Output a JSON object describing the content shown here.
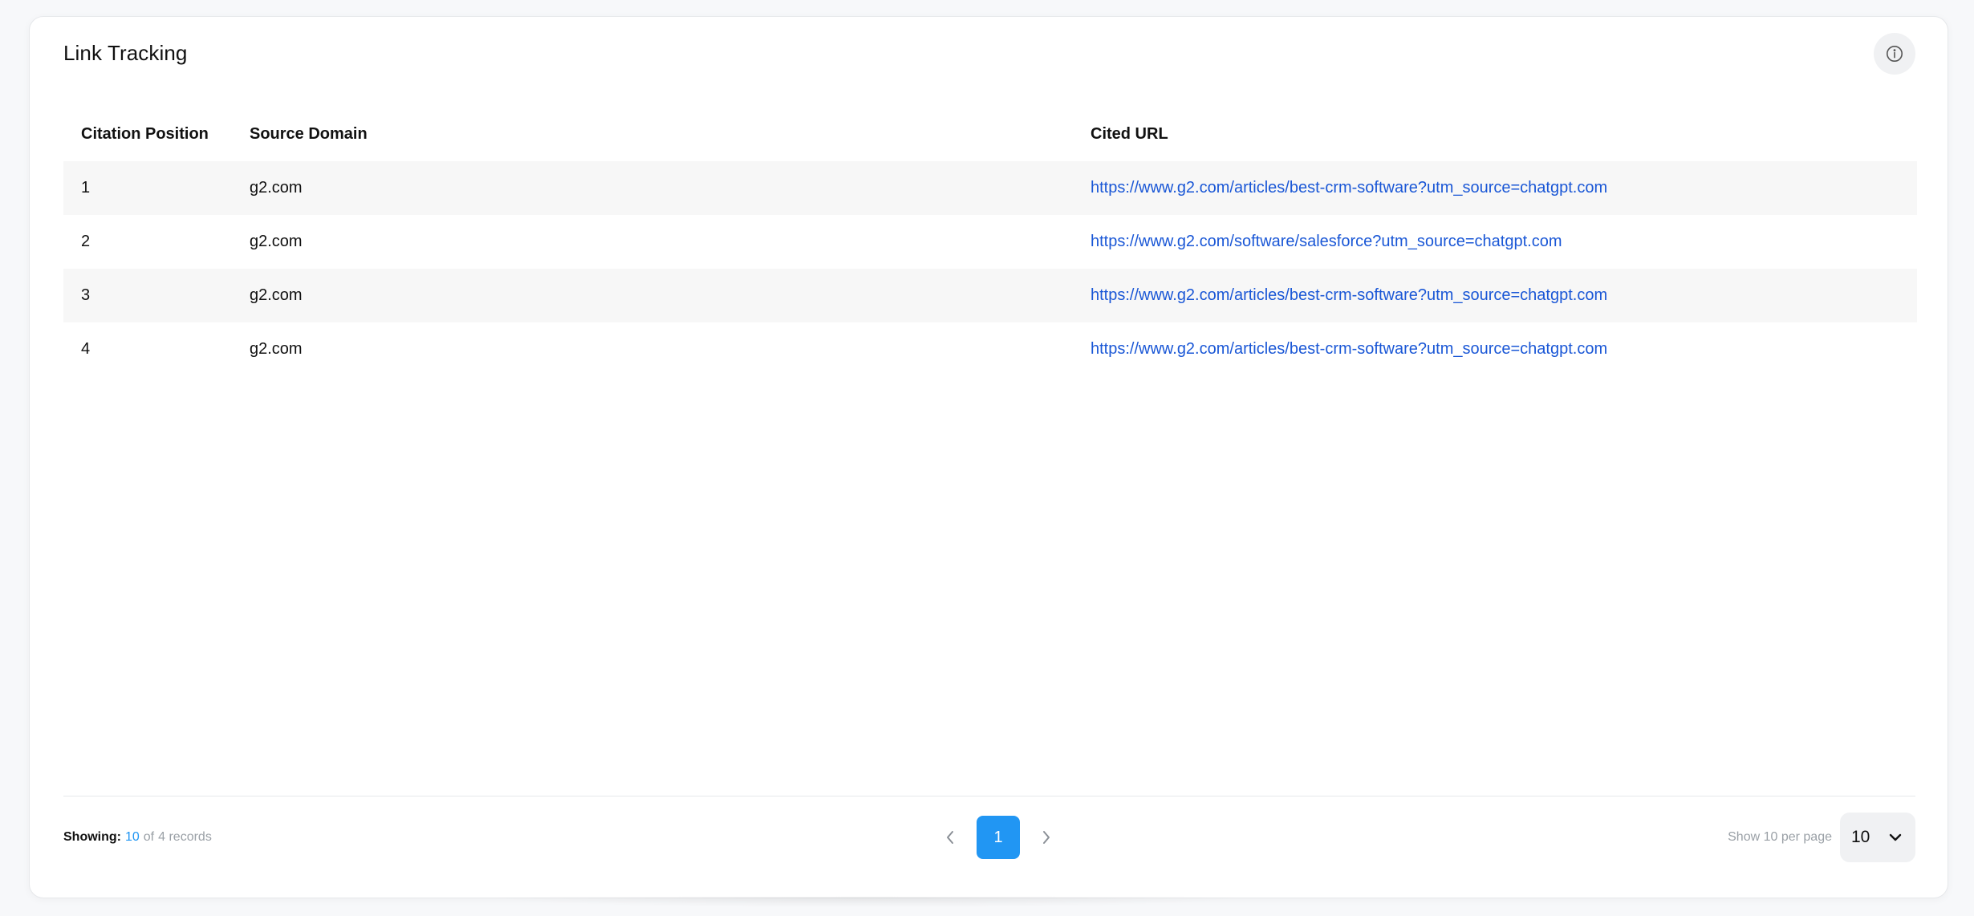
{
  "card": {
    "title": "Link Tracking",
    "info_icon": "info-circle-icon"
  },
  "table": {
    "columns": [
      "Citation Position",
      "Source Domain",
      "Cited URL"
    ],
    "rows": [
      {
        "position": "1",
        "domain": "g2.com",
        "url": "https://www.g2.com/articles/best-crm-software?utm_source=chatgpt.com"
      },
      {
        "position": "2",
        "domain": "g2.com",
        "url": "https://www.g2.com/software/salesforce?utm_source=chatgpt.com"
      },
      {
        "position": "3",
        "domain": "g2.com",
        "url": "https://www.g2.com/articles/best-crm-software?utm_source=chatgpt.com"
      },
      {
        "position": "4",
        "domain": "g2.com",
        "url": "https://www.g2.com/articles/best-crm-software?utm_source=chatgpt.com"
      }
    ]
  },
  "footer": {
    "showing_label": "Showing:",
    "showing_count": "10",
    "showing_of": "of",
    "showing_total": "4 records",
    "current_page": "1",
    "prev_icon": "chevron-left-icon",
    "next_icon": "chevron-right-icon",
    "per_page_label": "Show 10 per page",
    "per_page_value": "10",
    "per_page_icon": "chevron-down-icon"
  },
  "colors": {
    "accent": "#2196f3",
    "link": "#1a57d6",
    "row_stripe": "#f7f7f7",
    "muted_text": "#9aa0a6"
  }
}
